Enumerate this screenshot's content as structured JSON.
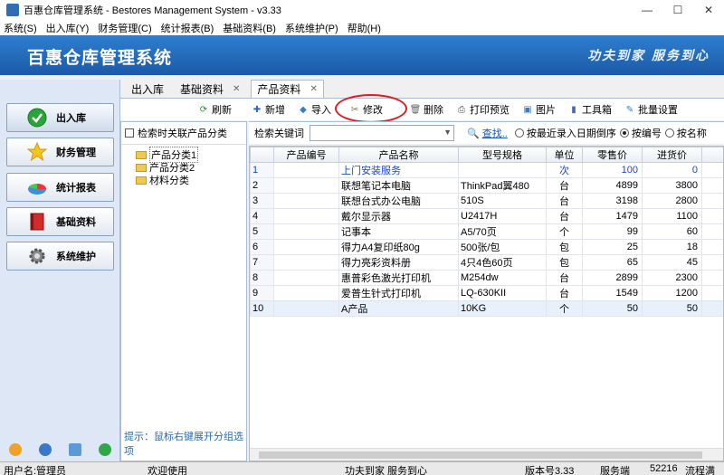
{
  "window": {
    "title": "百惠仓库管理系统 - Bestores Management System - v3.33",
    "minimize": "—",
    "maximize": "☐",
    "close": "✕"
  },
  "menu": [
    "系统(S)",
    "出入库(Y)",
    "财务管理(C)",
    "统计报表(B)",
    "基础资料(B)",
    "系统维护(P)",
    "帮助(H)"
  ],
  "banner": {
    "brand": "百惠仓库管理系统",
    "slogan": "功夫到家 服务到心"
  },
  "nav": [
    {
      "label": "出入库",
      "icon": "check-icon"
    },
    {
      "label": "财务管理",
      "icon": "star-icon"
    },
    {
      "label": "统计报表",
      "icon": "pie-chart-icon"
    },
    {
      "label": "基础资料",
      "icon": "book-icon"
    },
    {
      "label": "系统维护",
      "icon": "gear-icon"
    }
  ],
  "tabs": [
    {
      "label": "出入库"
    },
    {
      "label": "基础资料"
    },
    {
      "label": "产品资料"
    }
  ],
  "toolbar": {
    "refresh": "刷新",
    "add": "新增",
    "import": "导入",
    "edit": "修改",
    "delete": "删除",
    "print": "打印预览",
    "image": "图片",
    "toolbox": "工具箱",
    "batch": "批量设置"
  },
  "tree": {
    "checkbox_label": "检索时关联产品分类",
    "items": [
      "产品分类1",
      "产品分类2",
      "材料分类"
    ],
    "tip": "提示：鼠标右键展开分组选项"
  },
  "search": {
    "label": "检索关键词",
    "find": "查找..",
    "options": [
      "按最近录入日期倒序",
      "按编号",
      "按名称"
    ],
    "selected": "按编号"
  },
  "grid": {
    "columns": [
      "",
      "产品编号",
      "产品名称",
      "型号规格",
      "单位",
      "零售价",
      "进货价",
      "服"
    ],
    "rows": [
      [
        "1",
        "",
        "上门安装服务",
        "",
        "次",
        "100",
        "0"
      ],
      [
        "2",
        "",
        "联想笔记本电脑",
        "ThinkPad翼480",
        "台",
        "4899",
        "3800"
      ],
      [
        "3",
        "",
        "联想台式办公电脑",
        "510S",
        "台",
        "3198",
        "2800"
      ],
      [
        "4",
        "",
        "戴尔显示器",
        "U2417H",
        "台",
        "1479",
        "1100"
      ],
      [
        "5",
        "",
        "记事本",
        "A5/70页",
        "个",
        "99",
        "60"
      ],
      [
        "6",
        "",
        "得力A4复印纸80g",
        "500张/包",
        "包",
        "25",
        "18"
      ],
      [
        "7",
        "",
        "得力亮彩资料册",
        "4只4色60页",
        "包",
        "65",
        "45"
      ],
      [
        "8",
        "",
        "惠普彩色激光打印机",
        "M254dw",
        "台",
        "2899",
        "2300"
      ],
      [
        "9",
        "",
        "爱普生针式打印机",
        "LQ-630KII",
        "台",
        "1549",
        "1200"
      ],
      [
        "10",
        "",
        "A产品",
        "10KG",
        "个",
        "50",
        "50"
      ]
    ]
  },
  "status": {
    "user": "用户名:管理员",
    "welcome": "欢迎使用",
    "slogan": "功夫到家 服务到心",
    "version": "版本号3.33",
    "service": "服务端",
    "port": "52216",
    "more": "流程满"
  }
}
